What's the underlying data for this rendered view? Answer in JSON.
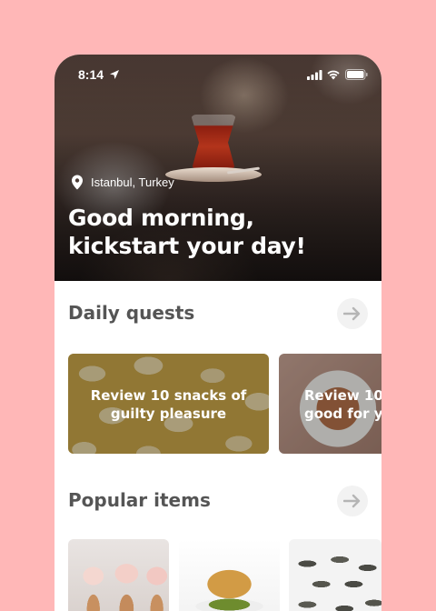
{
  "status_bar": {
    "time": "8:14"
  },
  "hero": {
    "location": "Istanbul, Turkey",
    "greeting_line1": "Good morning,",
    "greeting_line2": "kickstart your day!"
  },
  "daily_quests": {
    "title": "Daily quests",
    "cards": [
      {
        "line1": "Review 10 snacks of",
        "line2": "guilty pleasure"
      },
      {
        "line1": "Review 10",
        "line2": "good for yo"
      }
    ]
  },
  "popular_items": {
    "title": "Popular items",
    "items": [
      {
        "icon": "cupcakes-image"
      },
      {
        "icon": "baklava-image"
      },
      {
        "icon": "sunflower-seeds-image"
      }
    ]
  },
  "colors": {
    "background": "#ffb7b7",
    "title_text": "#555555",
    "arrow_button_bg": "#f2f2f2",
    "arrow_color": "#b5b5b5"
  }
}
